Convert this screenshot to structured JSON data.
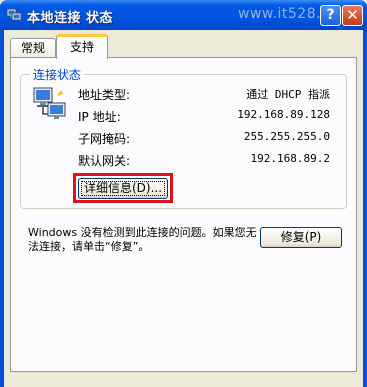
{
  "window": {
    "title": "本地连接 状态",
    "watermark": "www.it528.com",
    "help_label": "?",
    "close_label": "✕"
  },
  "tabs": [
    {
      "label": "常规",
      "selected": false
    },
    {
      "label": "支持",
      "selected": true
    }
  ],
  "status_group": {
    "title": "连接状态",
    "icon": "network-connection-icon",
    "rows": [
      {
        "label": "地址类型:",
        "value": "通过 DHCP 指派"
      },
      {
        "label": "IP 地址:",
        "value": "192.168.89.128"
      },
      {
        "label": "子网掩码:",
        "value": "255.255.255.0"
      },
      {
        "label": "默认网关:",
        "value": "192.168.89.2"
      }
    ],
    "details_button": "详细信息(D)..."
  },
  "message": "Windows 没有检测到此连接的问题。如果您无法连接，请单击“修复”。",
  "repair_button": "修复(P)",
  "colors": {
    "titlebar": "#0055e0",
    "group_title": "#0046d5",
    "highlight": "#e2101a"
  }
}
